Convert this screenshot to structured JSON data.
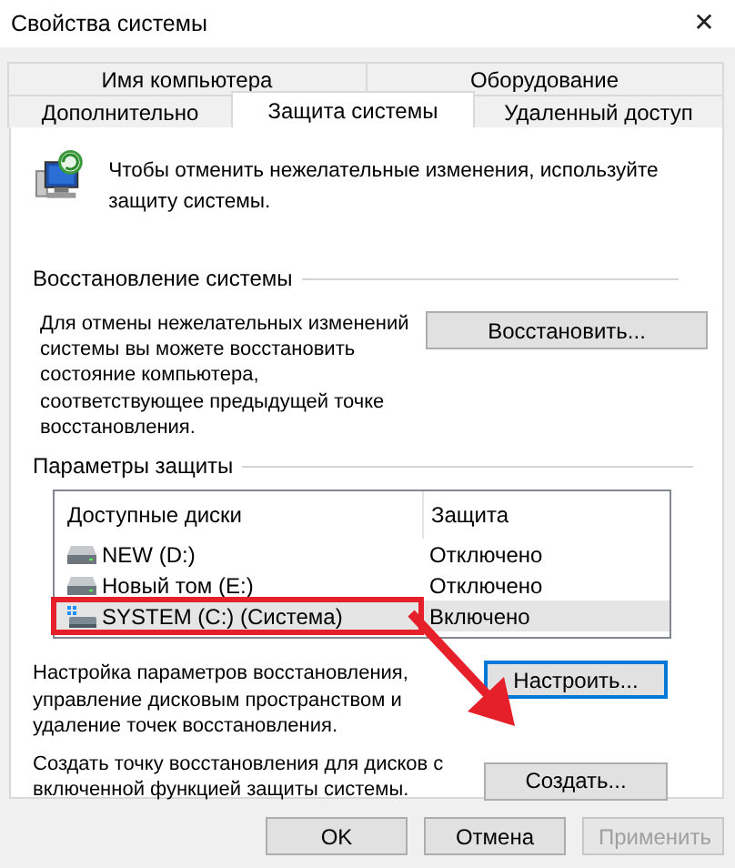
{
  "window": {
    "title": "Свойства системы",
    "close": "✕"
  },
  "tab_rows": [
    [
      {
        "label": "Имя компьютера",
        "selected": false
      },
      {
        "label": "Оборудование",
        "selected": false
      }
    ],
    [
      {
        "label": "Дополнительно",
        "selected": false
      },
      {
        "label": "Защита системы",
        "selected": true
      },
      {
        "label": "Удаленный доступ",
        "selected": false
      }
    ]
  ],
  "intro": "Чтобы отменить нежелательные изменения, используйте защиту системы.",
  "restore": {
    "heading": "Восстановление системы",
    "text": "Для отмены нежелательных изменений системы вы можете восстановить состояние компьютера, соответствующее предыдущей точке восстановления.",
    "button": "Восстановить..."
  },
  "protection": {
    "heading": "Параметры защиты",
    "columns": [
      "Доступные диски",
      "Защита"
    ],
    "rows": [
      {
        "kind": "drive",
        "name": "NEW (D:)",
        "status": "Отключено",
        "selected": false,
        "highlighted": false
      },
      {
        "kind": "drive",
        "name": "Новый том (E:)",
        "status": "Отключено",
        "selected": false,
        "highlighted": false
      },
      {
        "kind": "system",
        "name": "SYSTEM (C:) (Система)",
        "status": "Включено",
        "selected": true,
        "highlighted": true
      }
    ],
    "configure_text": "Настройка параметров восстановления, управление дисковым пространством и удаление точек восстановления.",
    "configure_button": "Настроить...",
    "create_text": "Создать точку восстановления для дисков с включенной функцией защиты системы.",
    "create_button": "Создать..."
  },
  "buttons": [
    {
      "label": "OK",
      "disabled": false
    },
    {
      "label": "Отмена",
      "disabled": false
    },
    {
      "label": "Применить",
      "disabled": true
    }
  ]
}
